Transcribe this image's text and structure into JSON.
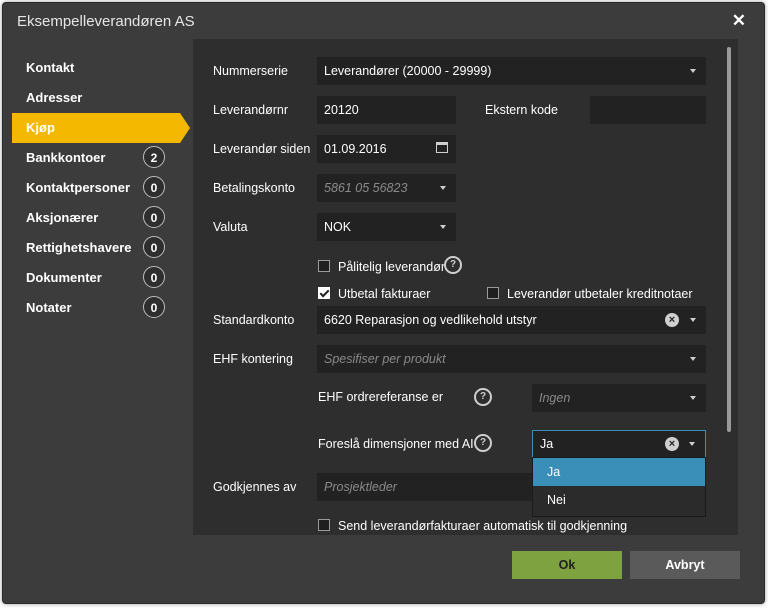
{
  "dialog": {
    "title": "Eksempelleverandøren AS",
    "close_symbol": "✕"
  },
  "sidebar": {
    "items": [
      {
        "label": "Kontakt"
      },
      {
        "label": "Adresser"
      },
      {
        "label": "Kjøp",
        "active": true
      },
      {
        "label": "Bankkontoer",
        "count": "2"
      },
      {
        "label": "Kontaktpersoner",
        "count": "0"
      },
      {
        "label": "Aksjonærer",
        "count": "0"
      },
      {
        "label": "Rettighetshavere",
        "count": "0"
      },
      {
        "label": "Dokumenter",
        "count": "0"
      },
      {
        "label": "Notater",
        "count": "0"
      }
    ]
  },
  "form": {
    "nummerserie": {
      "label": "Nummerserie",
      "value": "Leverandører (20000 - 29999)"
    },
    "leverandornr": {
      "label": "Leverandørnr",
      "value": "20120"
    },
    "ekstern_kode": {
      "label": "Ekstern kode",
      "value": ""
    },
    "leverandor_siden": {
      "label": "Leverandør siden",
      "value": "01.09.2016"
    },
    "betalingskonto": {
      "label": "Betalingskonto",
      "placeholder": "5861 05 56823"
    },
    "valuta": {
      "label": "Valuta",
      "value": "NOK"
    },
    "palitelig": {
      "label": "Pålitelig leverandør",
      "checked": false
    },
    "utbetal": {
      "label": "Utbetal fakturaer",
      "checked": true
    },
    "kreditnotaer": {
      "label": "Leverandør utbetaler kreditnotaer",
      "checked": false
    },
    "standardkonto": {
      "label": "Standardkonto",
      "value": "6620 Reparasjon og vedlikehold utstyr"
    },
    "ehf_kontering": {
      "label": "EHF kontering",
      "placeholder": "Spesifiser per produkt"
    },
    "ehf_ordreref": {
      "label": "EHF ordrereferanse er",
      "placeholder": "Ingen"
    },
    "foresla_dim": {
      "label": "Foreslå dimensjoner med AI",
      "value": "Ja",
      "options": [
        "Ja",
        "Nei"
      ]
    },
    "godkjennes": {
      "label": "Godkjennes av",
      "placeholder": "Prosjektleder"
    },
    "send_auto": {
      "label": "Send leverandørfakturaer automatisk til godkjenning",
      "checked": false
    }
  },
  "footer": {
    "ok_label": "Ok",
    "cancel_label": "Avbryt"
  },
  "colors": {
    "accent": "#f5b800",
    "ok": "#7ea23f",
    "focus": "#3a8fb8",
    "cancel": "#5a5a5a"
  }
}
